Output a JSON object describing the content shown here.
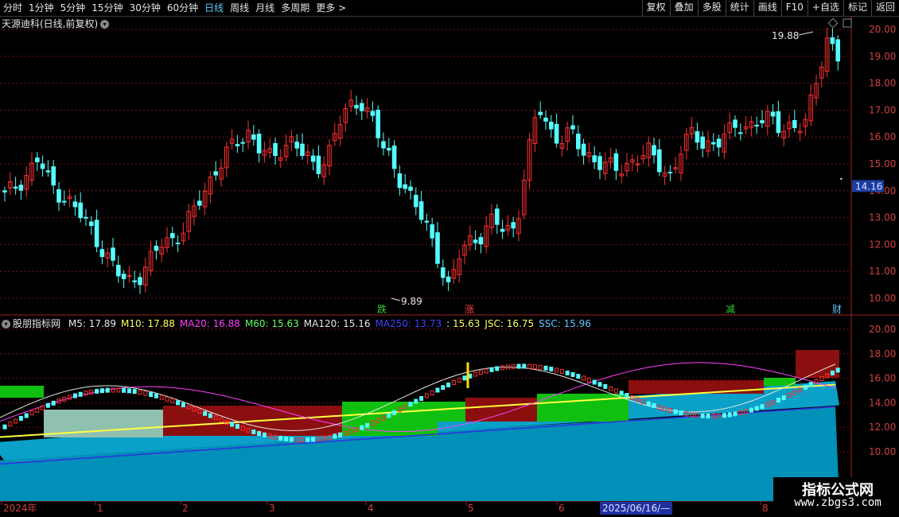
{
  "toolbar": {
    "periods": [
      "分时",
      "1分钟",
      "5分钟",
      "15分钟",
      "30分钟",
      "60分钟",
      "日线",
      "周线",
      "月线",
      "多周期",
      "更多 >"
    ],
    "active_period": "日线",
    "buttons": [
      "复权",
      "叠加",
      "多股",
      "统计",
      "画线",
      "F10",
      "+自选",
      "标记",
      "返回"
    ]
  },
  "chart_title": "天源迪科(日线,前复权)",
  "price_axis": [
    "20.00",
    "19.00",
    "18.00",
    "17.00",
    "16.00",
    "15.00",
    "14.00",
    "13.00",
    "12.00",
    "11.00",
    "10.00"
  ],
  "current_price": "14.16",
  "high_label": "19.88",
  "low_label": "9.89",
  "signals": [
    {
      "text": "跌",
      "color": "#30d030"
    },
    {
      "text": "涨",
      "color": "#ff4040"
    },
    {
      "text": "减",
      "color": "#30d030"
    },
    {
      "text": "财",
      "color": "#5ec8ff"
    }
  ],
  "indicator": {
    "name": "股朋指标网",
    "items": [
      {
        "label": "M5: 17.89",
        "color": "#e6e6e6"
      },
      {
        "label": "M10: 17.88",
        "color": "#ffff60"
      },
      {
        "label": "MA20: 16.88",
        "color": "#ff40ff"
      },
      {
        "label": "M60: 15.63",
        "color": "#60ff60"
      },
      {
        "label": "MA120: 15.16",
        "color": "#e6e6e6"
      },
      {
        "label": "MA250: 13.73",
        "color": "#4040ff"
      },
      {
        "label": ": 15.63",
        "color": "#ffff60"
      },
      {
        "label": "JSC: 16.75",
        "color": "#ffff60"
      },
      {
        "label": "SSC: 15.96",
        "color": "#5ec8ff"
      }
    ]
  },
  "indicator_axis": [
    "20.00",
    "18.00",
    "16.00",
    "14.00",
    "12.00",
    "10.00"
  ],
  "x_axis": [
    "2024年",
    "1",
    "2",
    "3",
    "4",
    "5",
    "6",
    "8"
  ],
  "date_tag": "2025/06/16/—",
  "watermark": {
    "title": "指标公式网",
    "url": "www.zbgs3.com"
  },
  "colors": {
    "up": "#ff3030",
    "down": "#54ffff",
    "grid": "#7a1010",
    "fill_cyan": "#0090b8",
    "fill_red": "#8b0f0f",
    "fill_green": "#10c010"
  }
}
